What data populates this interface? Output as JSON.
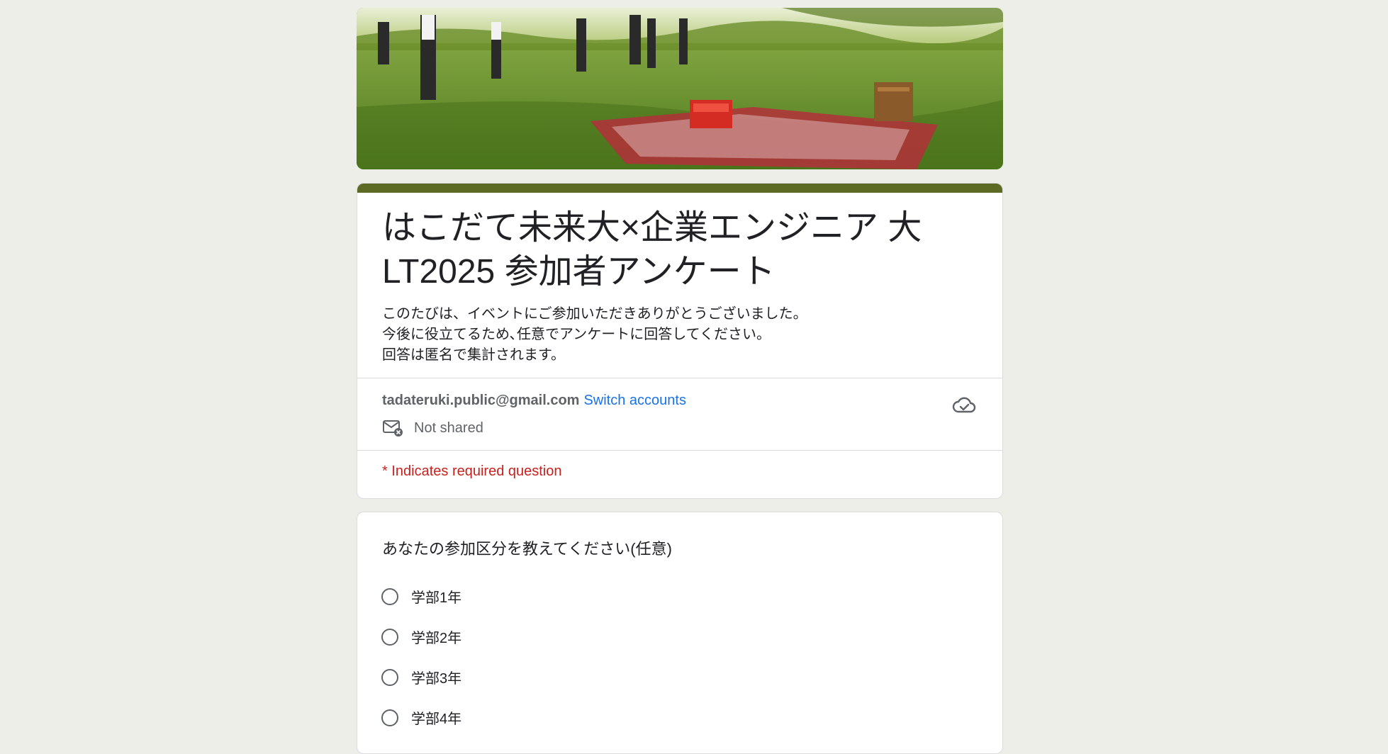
{
  "form": {
    "title": "はこだて未来大×企業エンジニア 大LT2025 参加者アンケート",
    "description": [
      "このたびは、イベントにご参加いただきありがとうございました。",
      "今後に役立てるため､任意でアンケートに回答してください。",
      "回答は匿名で集計されます。"
    ],
    "accent_color": "#5d6a23"
  },
  "account": {
    "email": "tadateruki.public@gmail.com",
    "switch_label": "Switch accounts",
    "email_status": "Not shared"
  },
  "required_note": "* Indicates required question",
  "question": {
    "title": "あなたの参加区分を教えてください(任意)",
    "options": [
      "学部1年",
      "学部2年",
      "学部3年",
      "学部4年"
    ]
  },
  "colors": {
    "link": "#1a73e8",
    "required": "#c5221f",
    "background": "#eeeee9"
  },
  "icons": {
    "cloud": "cloud-saved-icon",
    "mail": "mail-not-shared-icon"
  }
}
